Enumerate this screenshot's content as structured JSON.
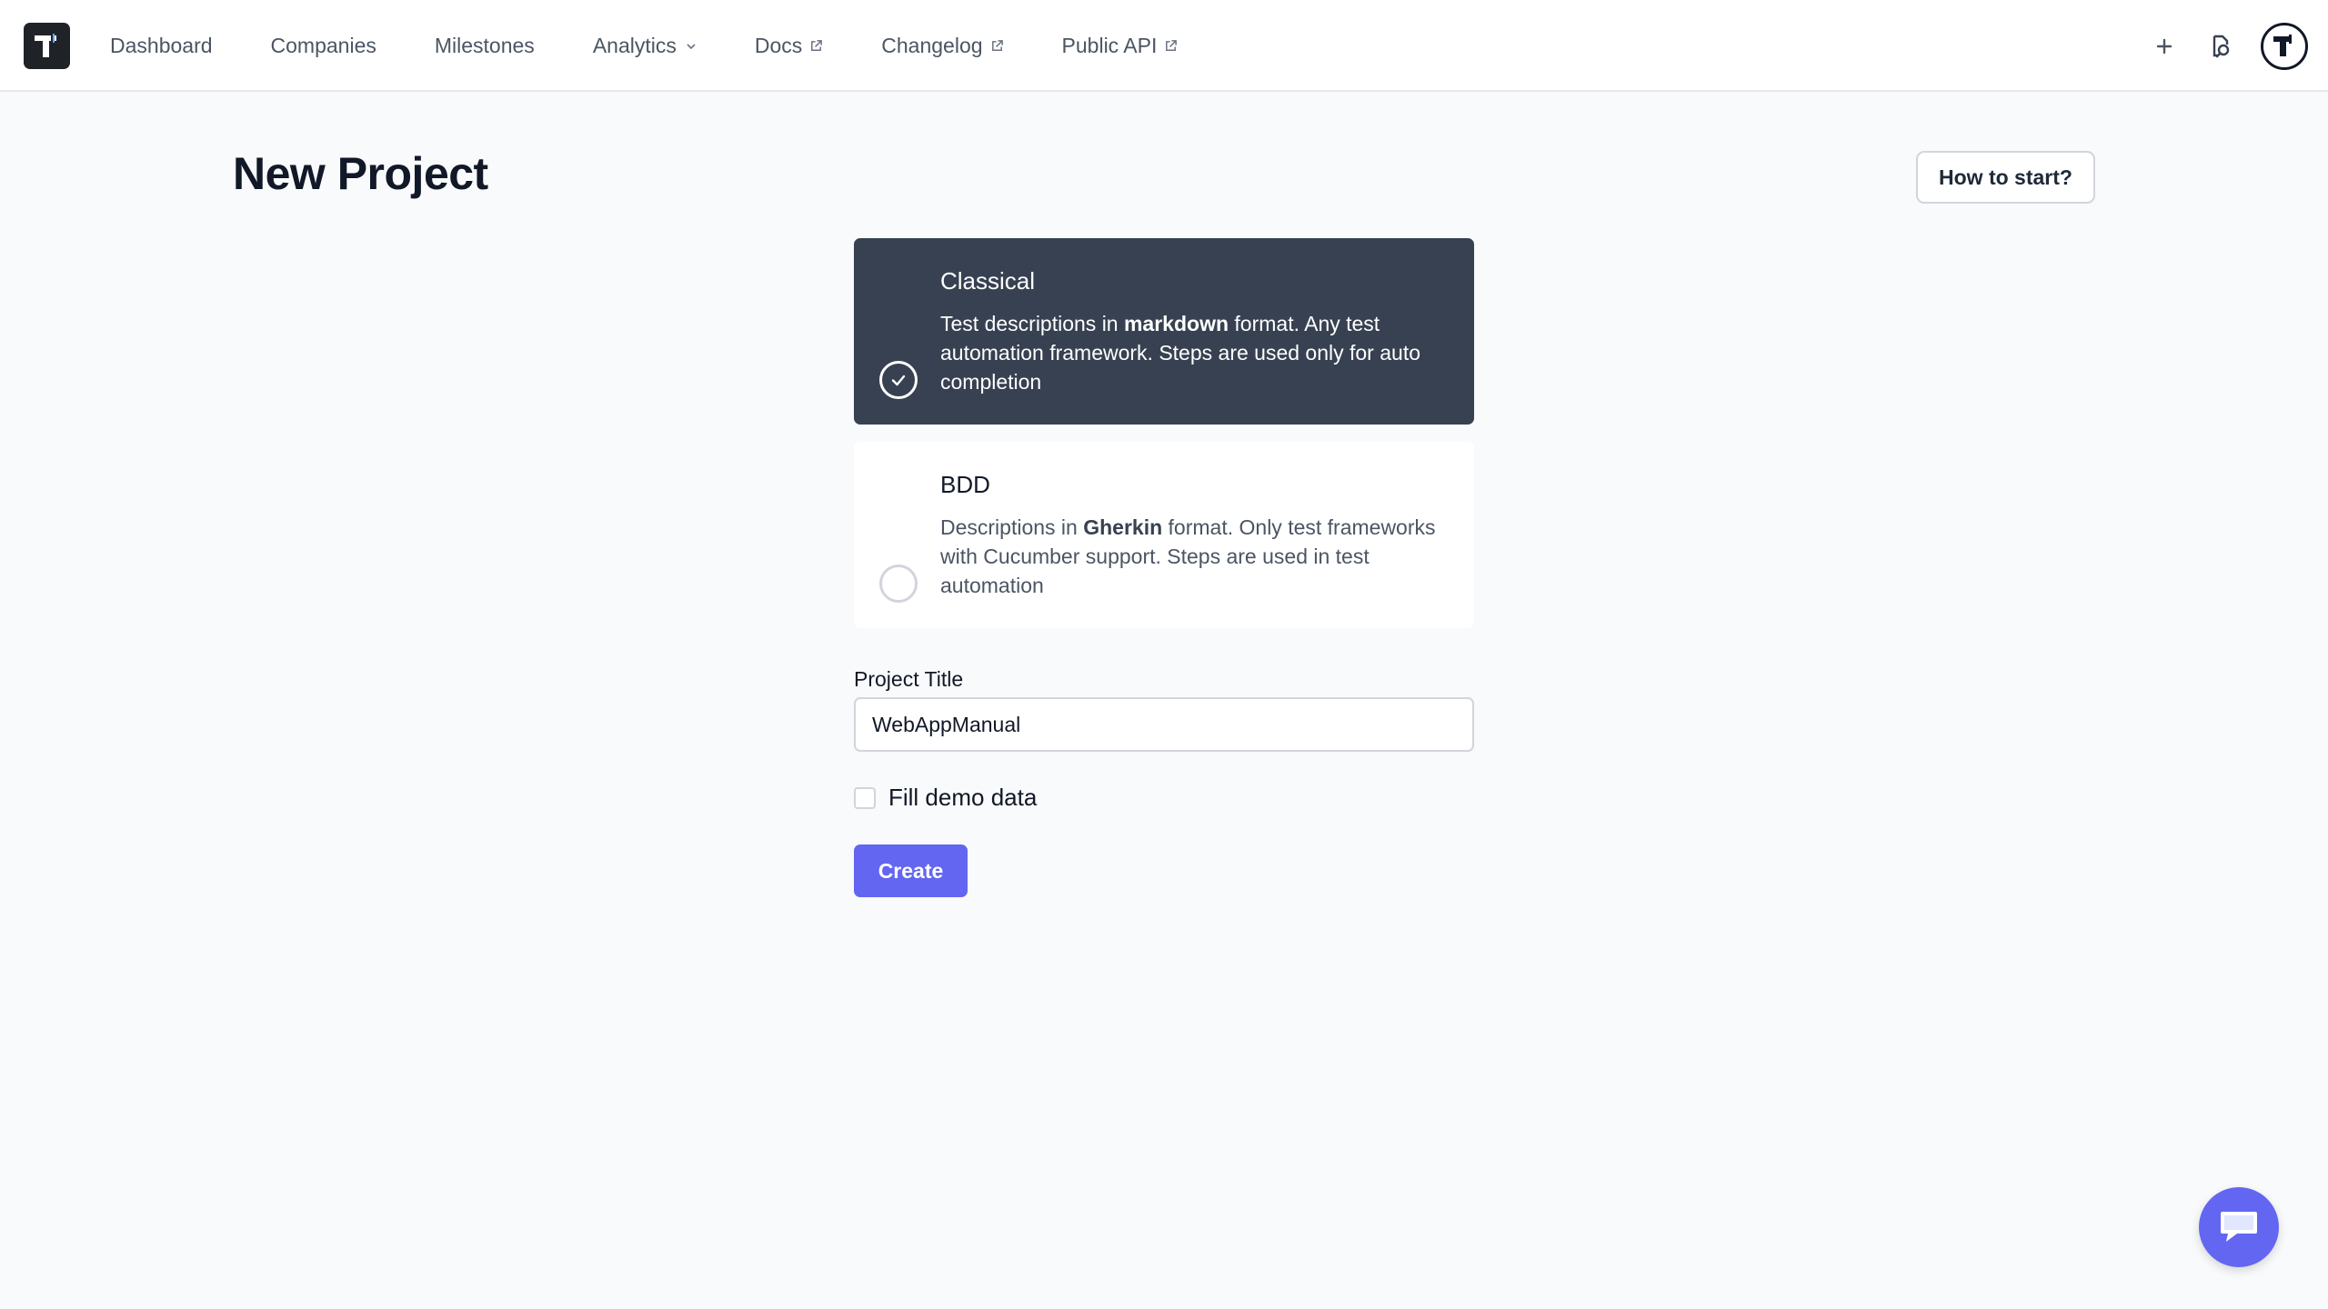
{
  "nav": {
    "links": [
      {
        "label": "Dashboard",
        "icon": null
      },
      {
        "label": "Companies",
        "icon": null
      },
      {
        "label": "Milestones",
        "icon": null
      },
      {
        "label": "Analytics",
        "icon": "chevron-down-icon"
      },
      {
        "label": "Docs",
        "icon": "external-link-icon"
      },
      {
        "label": "Changelog",
        "icon": "external-link-icon"
      },
      {
        "label": "Public API",
        "icon": "external-link-icon"
      }
    ],
    "right_icons": [
      "plus-icon",
      "search-icon",
      "avatar"
    ]
  },
  "page": {
    "title": "New Project",
    "help_button": "How to start?"
  },
  "options": {
    "classical": {
      "title": "Classical",
      "desc_pre": "Test descriptions in ",
      "desc_bold": "markdown",
      "desc_post": " format. Any test automation framework. Steps are used only for auto completion",
      "selected": true
    },
    "bdd": {
      "title": "BDD",
      "desc_pre": "Descriptions in ",
      "desc_bold": "Gherkin",
      "desc_post": " format. Only test frameworks with Cucumber support. Steps are used in test automation",
      "selected": false
    }
  },
  "form": {
    "title_label": "Project Title",
    "title_value": "WebAppManual",
    "demo_label": "Fill demo data",
    "demo_checked": false,
    "create_label": "Create"
  },
  "colors": {
    "accent": "#6366f1",
    "selected_card": "#374151",
    "background": "#f9fafb"
  }
}
